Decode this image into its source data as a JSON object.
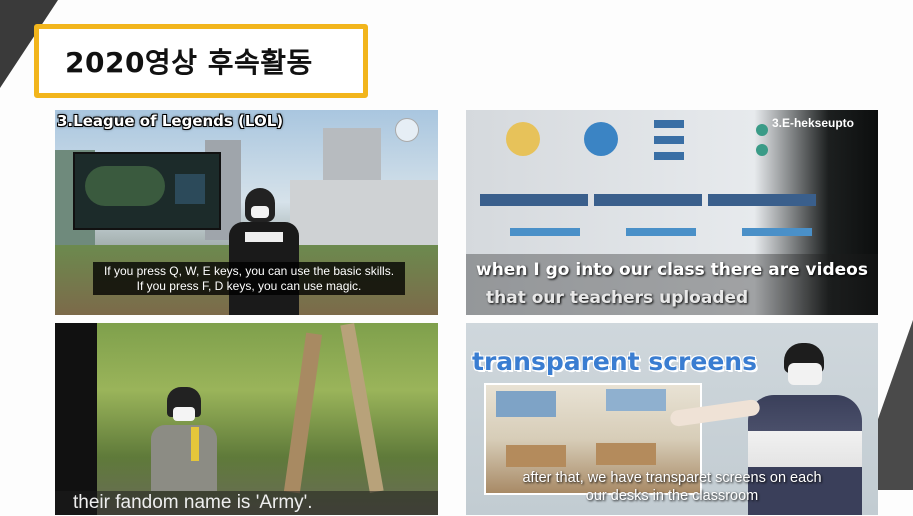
{
  "slide": {
    "title": "2020영상 후속활동",
    "accent": "#f2b51c"
  },
  "panels": [
    {
      "heading": "3.League of Legends (LOL)",
      "caption_line1": "If you press Q, W, E keys, you can use the basic skills.",
      "caption_line2": "If you press F, D keys, you can use magic."
    },
    {
      "tag": "3.E-hekseupto",
      "caption_line1": "when I go into our class there are videos",
      "caption_line2": "that our teachers uploaded"
    },
    {
      "caption_line1": "their fandom name is 'Army'."
    },
    {
      "heading": "transparent screens",
      "caption_line1": "after that, we have transparet screens on each",
      "caption_line2": "our desks in the classroom"
    }
  ]
}
